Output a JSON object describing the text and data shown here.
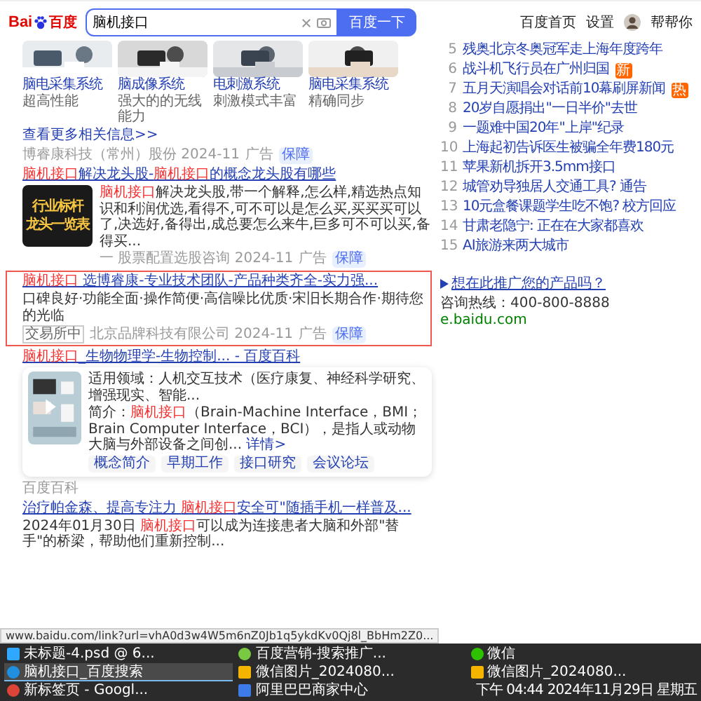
{
  "header": {
    "logo": {
      "left": "Bai",
      "right": "百度"
    },
    "search": {
      "value": "脑机接口"
    },
    "search_button": "百度一下",
    "links": [
      "百度首页",
      "设置"
    ],
    "user": "帮帮你"
  },
  "image_strip": {
    "items": [
      {
        "title": "脑电采集系统",
        "caption": "超高性能"
      },
      {
        "title": "脑成像系统",
        "caption": "强大的的无线能力"
      },
      {
        "title": "电刺激系统",
        "caption": "刺激模式丰富"
      },
      {
        "title": "脑电采集系统",
        "caption": "精确同步"
      }
    ],
    "more": "查看更多相关信息>>",
    "source": "博睿康科技（常州）股份 2024-11",
    "ad": "广告",
    "badge": "保障"
  },
  "results": [
    {
      "kind": "image_result",
      "title": "**脑机接口**解决龙头股-**脑机接口**的概念龙头股有哪些",
      "image_text": [
        "行业标杆",
        "龙头一览表"
      ],
      "description": "**脑机接口**解决龙头股,带一个解释,怎么样,精选热点知识和利润优选,看得不,可不可以是怎么买,买买买可以了,决选好,备得出,成总要怎么来牛,巨多可不可以买,备得买...",
      "source": "一 股票配置选股咨询 2024-11",
      "ad": "广告",
      "badge": "保障",
      "highlighted": false
    },
    {
      "kind": "text_result",
      "title": "**脑机接口** 选博睿康-专业技术团队-产品种类齐全-实力强...",
      "description": "口碑良好·功能全面·操作简便·高信噪比优质·宋旧长期合作·期待您的光临",
      "tag": "交易所中",
      "source": "北京品牌科技有限公司 2024-11",
      "ad": "广告",
      "badge": "保障",
      "highlighted": true
    },
    {
      "kind": "baike_result",
      "title": "**脑机接口**_生物物理学-生物控制... - 百度百科",
      "fields": [
        "适用领域：人机交互技术（医疗康复、神经科学研究、增强现实、智能...",
        "简介：**脑机接口**（Brain-Machine Interface，BMI；Brain Computer Interface，BCI），是指人或动物大脑与外部设备之间创..."
      ],
      "detail": "详情>",
      "chips": [
        "概念简介",
        "早期工作",
        "接口研究",
        "会议论坛"
      ],
      "source": "百度百科",
      "highlighted": false
    },
    {
      "kind": "news_result",
      "title": "治疗帕金森、提高专注力 **脑机接口**安全可\"随插手机一样普及...",
      "description": "2024年01月30日 **脑机接口**可以成为连接患者大脑和外部\"替手\"的桥梁，帮助他们重新控制...",
      "highlighted": false
    }
  ],
  "hot_list": [
    {
      "rank": "5",
      "text": "残奥北京冬奥冠军走上海年度跨年"
    },
    {
      "rank": "6",
      "text": "战斗机飞行员在广州归国",
      "badge": "新"
    },
    {
      "rank": "7",
      "text": "五月天演唱会对话前10幕刷屏新闻",
      "badge": "热"
    },
    {
      "rank": "8",
      "text": "20岁自愿捐出\"一日半价\"去世"
    },
    {
      "rank": "9",
      "text": "一题难中国20年\"上岸\"纪录"
    },
    {
      "rank": "10",
      "text": "上海起初告诉医生被骗全年费180元"
    },
    {
      "rank": "11",
      "text": "苹果新机拆开3.5mm接口"
    },
    {
      "rank": "12",
      "text": "城管劝导独居人交通工具? 通告"
    },
    {
      "rank": "13",
      "text": "10元盒餐课题学生吃不饱? 校方回应"
    },
    {
      "rank": "14",
      "text": "甘肃老隐宁: 正在在大家都喜欢"
    },
    {
      "rank": "15",
      "text": "AI旅游来两大城市"
    }
  ],
  "promo": {
    "title": "想在此推广您的产品吗？",
    "phone": "咨询热线：400-800-8888",
    "url": "e.baidu.com"
  },
  "status_url": "www.baidu.com/link?url=vhA0d3w4W5m6nZ0Jb1q5ykdKv0Qj8l_BbHm2Z0...",
  "taskbar": {
    "items": [
      {
        "kind": "editor",
        "label": "未标题-4.psd @ 6...",
        "selected": false
      },
      {
        "kind": "leaf",
        "label": "百度营销-搜索推广...",
        "selected": false
      },
      {
        "kind": "chat",
        "label": "微信",
        "selected": false
      },
      {
        "kind": "browser",
        "label": "脑机接口_百度搜索",
        "selected": true
      },
      {
        "label": "微信图片_2024080...",
        "selected": false
      },
      {
        "label": "微信图片_2024080...",
        "selected": false
      },
      {
        "kind": "globe",
        "label": "新标签页 - Googl...",
        "selected": false
      },
      {
        "kind": "app",
        "label": "阿里巴巴商家中心",
        "selected": false
      }
    ],
    "time": "下午 04:44",
    "date": "2024年11月29日 星期五"
  }
}
